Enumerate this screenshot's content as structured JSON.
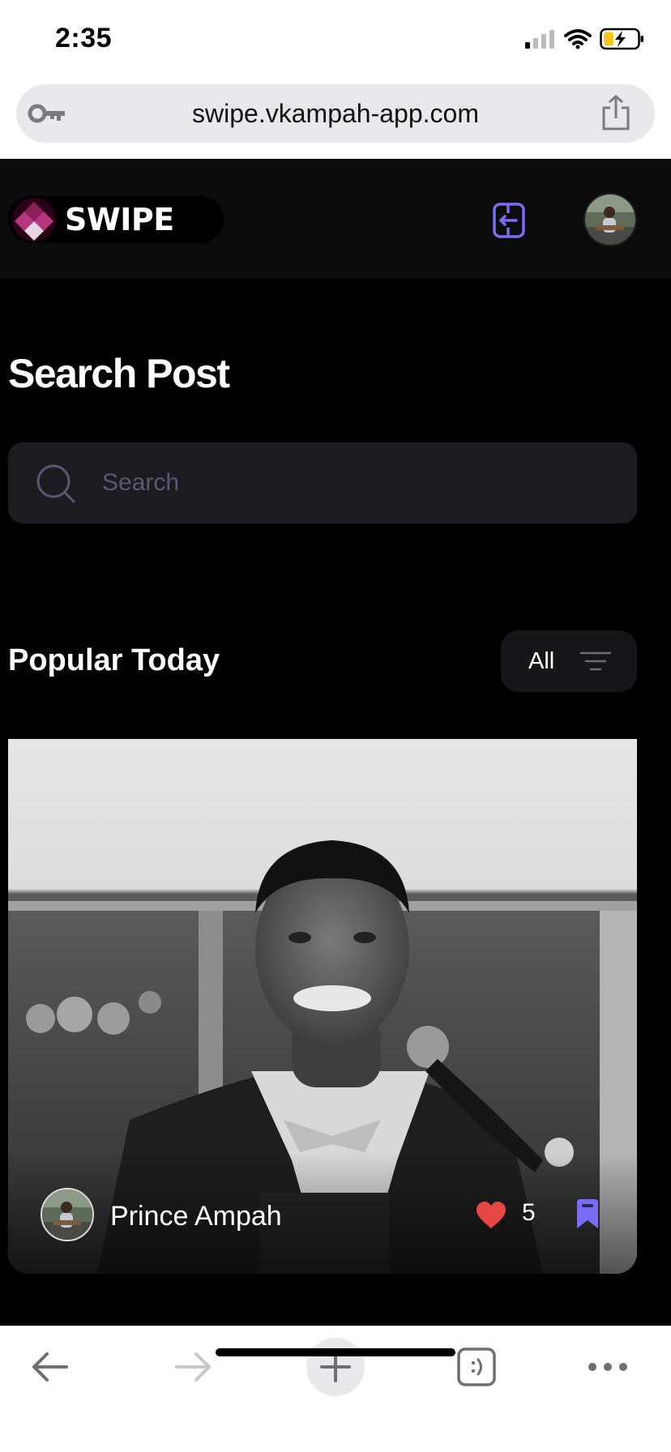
{
  "status_bar": {
    "time": "2:35"
  },
  "browser": {
    "url": "swipe.vkampah-app.com"
  },
  "app": {
    "logo_text": "SWIPE",
    "brand_color": "#7b6cf6",
    "like_color": "#e84545"
  },
  "search": {
    "title": "Search Post",
    "placeholder": "Search",
    "value": ""
  },
  "popular": {
    "title": "Popular Today",
    "filter_label": "All",
    "posts": [
      {
        "author": "Prince Ampah",
        "likes": "5"
      }
    ]
  }
}
